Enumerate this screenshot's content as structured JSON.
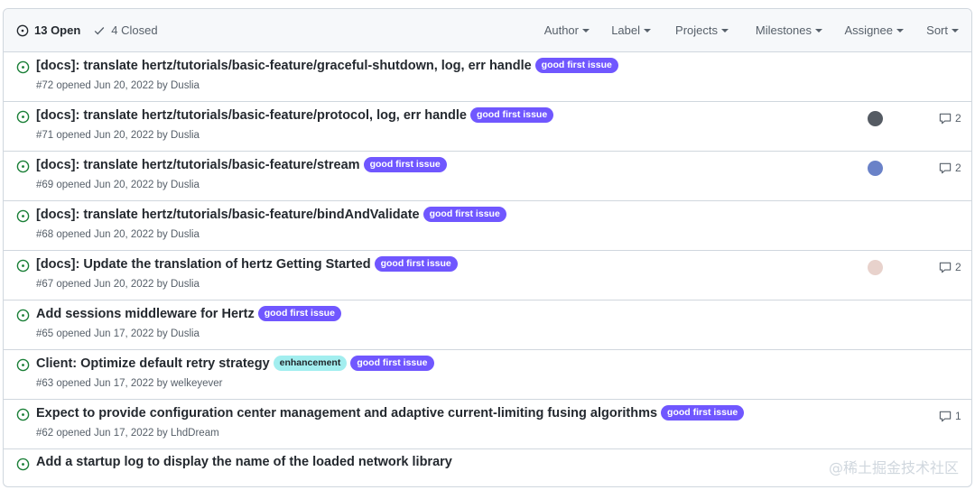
{
  "header": {
    "open_label": "13 Open",
    "closed_label": "4 Closed",
    "filters": [
      "Author",
      "Label",
      "Projects",
      "Milestones",
      "Assignee",
      "Sort"
    ]
  },
  "labels": {
    "good_first_issue": {
      "text": "good first issue",
      "bg": "#7057ff",
      "fg": "#ffffff"
    },
    "enhancement": {
      "text": "enhancement",
      "bg": "#a2eeef",
      "fg": "#1f2328"
    }
  },
  "issues": [
    {
      "title": "[docs]: translate hertz/tutorials/basic-feature/graceful-shutdown, log, err handle",
      "labels": [
        "good_first_issue"
      ],
      "meta": "#72 opened Jun 20, 2022 by Duslia",
      "assignee": null,
      "comments": null
    },
    {
      "title": "[docs]: translate hertz/tutorials/basic-feature/protocol, log, err handle",
      "labels": [
        "good_first_issue"
      ],
      "meta": "#71 opened Jun 20, 2022 by Duslia",
      "assignee": "#555b63",
      "comments": "2"
    },
    {
      "title": "[docs]: translate hertz/tutorials/basic-feature/stream",
      "labels": [
        "good_first_issue"
      ],
      "meta": "#69 opened Jun 20, 2022 by Duslia",
      "assignee": "#6a82c8",
      "comments": "2"
    },
    {
      "title": "[docs]: translate hertz/tutorials/basic-feature/bindAndValidate",
      "labels": [
        "good_first_issue"
      ],
      "meta": "#68 opened Jun 20, 2022 by Duslia",
      "assignee": null,
      "comments": null
    },
    {
      "title": "[docs]: Update the translation of hertz Getting Started",
      "labels": [
        "good_first_issue"
      ],
      "meta": "#67 opened Jun 20, 2022 by Duslia",
      "assignee": "#e8d2cc",
      "comments": "2"
    },
    {
      "title": "Add sessions middleware for Hertz",
      "labels": [
        "good_first_issue"
      ],
      "meta": "#65 opened Jun 17, 2022 by Duslia",
      "assignee": null,
      "comments": null
    },
    {
      "title": "Client: Optimize default retry strategy",
      "labels": [
        "enhancement",
        "good_first_issue"
      ],
      "meta": "#63 opened Jun 17, 2022 by welkeyever",
      "assignee": null,
      "comments": null
    },
    {
      "title": "Expect to provide configuration center management and adaptive current-limiting fusing algorithms",
      "labels": [
        "good_first_issue"
      ],
      "meta": "#62 opened Jun 17, 2022 by LhdDream",
      "assignee": null,
      "comments": "1"
    },
    {
      "title": "Add a startup log to display the name of the loaded network library",
      "labels": [],
      "meta": "",
      "assignee": null,
      "comments": null
    }
  ],
  "watermark": "@稀土掘金技术社区",
  "colors": {
    "open_icon": "#1a7f37",
    "border": "#d0d7de",
    "header_bg": "#f6f8fa"
  },
  "icons": {
    "open": "issue-opened-icon",
    "closed": "check-icon",
    "comment": "comment-icon"
  }
}
